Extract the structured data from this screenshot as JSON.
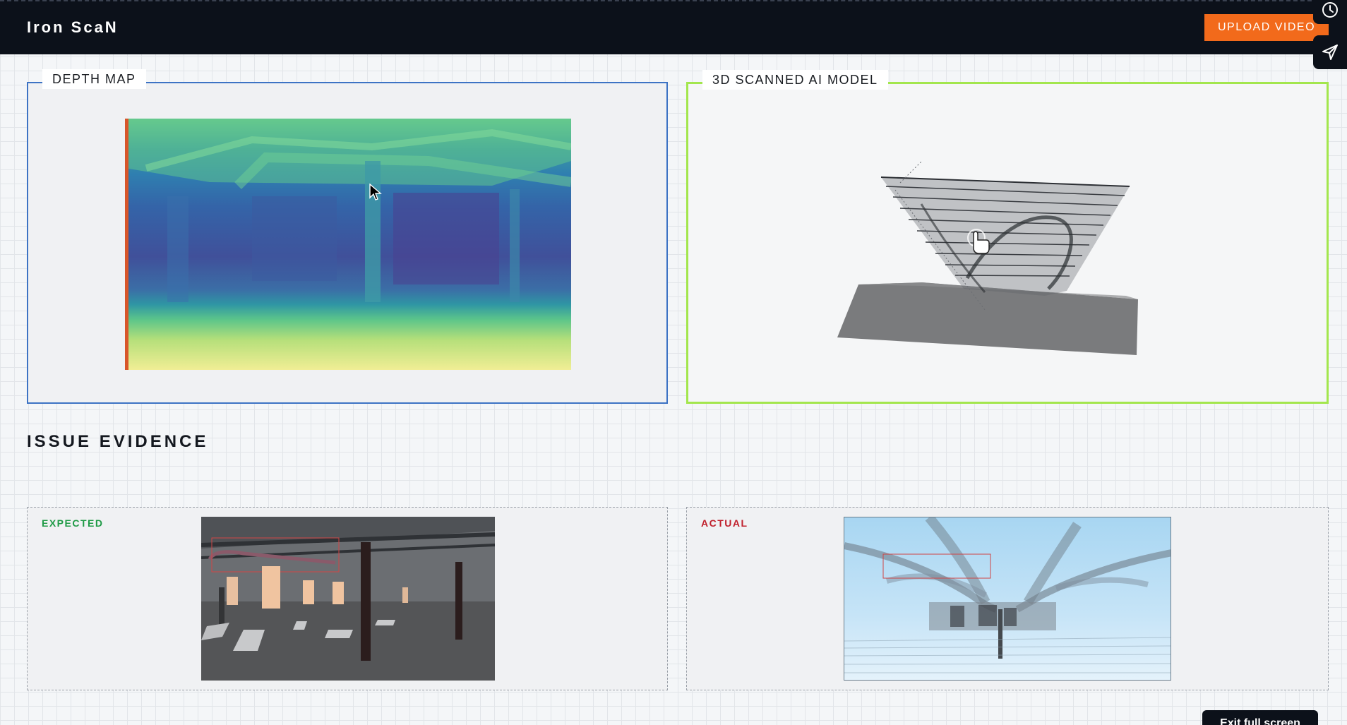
{
  "app": {
    "title": "Iron ScaN"
  },
  "header": {
    "upload_label": "UPLOAD VIDEO"
  },
  "side_actions": [
    {
      "icon": "clock-icon"
    },
    {
      "icon": "send-icon"
    }
  ],
  "panels": {
    "depth": {
      "title": "DEPTH MAP",
      "border_color": "#3d73c4"
    },
    "model": {
      "title": "3D SCANNED AI MODEL",
      "border_color": "#a3e64d"
    }
  },
  "issue_evidence": {
    "title": "ISSUE EVIDENCE",
    "expected": {
      "label": "EXPECTED",
      "color": "#1e9a45"
    },
    "actual": {
      "label": "ACTUAL",
      "color": "#c0202c"
    }
  },
  "footer": {
    "exit_label": "Exit full screen"
  },
  "colors": {
    "accent": "#f26a1b",
    "topbar": "#0c111a"
  }
}
